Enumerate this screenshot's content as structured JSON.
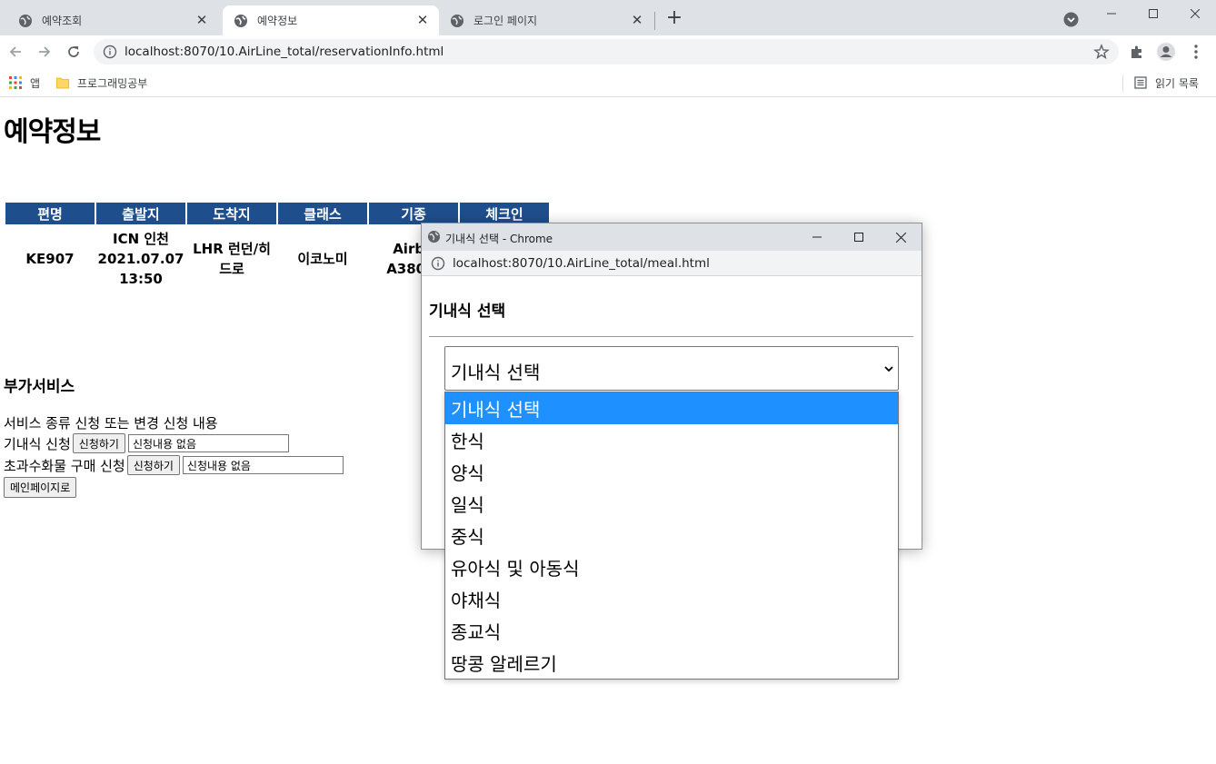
{
  "browser": {
    "tabs": [
      {
        "label": "예약조회"
      },
      {
        "label": "예약정보"
      },
      {
        "label": "로그인 페이지"
      }
    ],
    "url": "localhost:8070/10.AirLine_total/reservationInfo.html",
    "bookmarks": {
      "apps_label": "앱",
      "folder_label": "프로그래밍공부",
      "reading_list_label": "읽기 목록"
    }
  },
  "page": {
    "title": "예약정보",
    "table": {
      "headers": [
        "편명",
        "출발지",
        "도착지",
        "클래스",
        "기종",
        "체크인"
      ],
      "row": {
        "flight": "KE907",
        "departure_line1": "ICN 인천",
        "departure_line2": "2021.07.07",
        "departure_line3": "13:50",
        "arrival_line1": "LHR 런던/히",
        "arrival_line2": "드로",
        "class": "이코노미",
        "aircraft_line1": "Airbu",
        "aircraft_line2": "A380-8"
      }
    },
    "extra_services": {
      "title": "부가서비스",
      "header": "서비스 종류 신청 또는 변경 신청 내용",
      "meal_label": "기내식 신청",
      "meal_button": "신청하기",
      "meal_value": "신청내용 없음",
      "baggage_label": "초과수화물 구매 신청",
      "baggage_button": "신청하기",
      "baggage_value": "신청내용 없음",
      "main_button": "메인페이지로"
    }
  },
  "popup": {
    "window_title": "기내식 선택 - Chrome",
    "url": "localhost:8070/10.AirLine_total/meal.html",
    "heading": "기내식 선택",
    "select_value": "기내식 선택",
    "options": [
      "기내식 선택",
      "한식",
      "양식",
      "일식",
      "중식",
      "유아식 및 아동식",
      "야채식",
      "종교식",
      "땅콩 알레르기"
    ],
    "selected_index": 0
  },
  "colors": {
    "table_header_bg": "#1f4e8c",
    "option_highlight": "#1e90ff",
    "tabstrip_bg": "#dee1e6"
  }
}
